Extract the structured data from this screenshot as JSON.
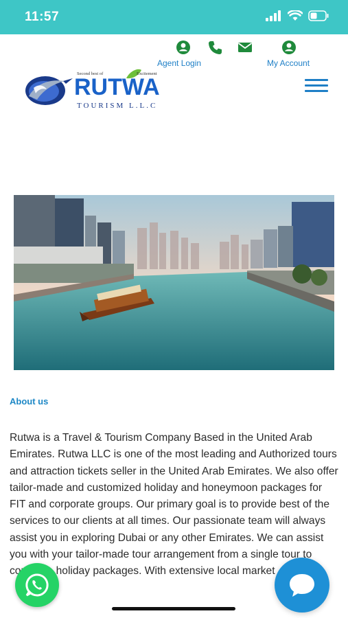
{
  "status_bar": {
    "time": "11:57",
    "icons": [
      "signal-icon",
      "wifi-icon",
      "battery-icon"
    ]
  },
  "topbar": {
    "agent_login": "Agent Login",
    "my_account": "My Account",
    "icons": [
      "user-circle-icon",
      "phone-icon",
      "mail-icon",
      "user-circle-icon"
    ],
    "accent": "#1f8a3b"
  },
  "logo": {
    "name": "RUTWA",
    "tagline": "TOURISM L.L.C",
    "slogan_left": "Second best of",
    "slogan_right": "Excitement"
  },
  "about": {
    "title": "About us",
    "body": "Rutwa is a Travel & Tourism Company Based in the United Arab Emirates. Rutwa LLC is one of the most leading and Authorized tours and attraction tickets seller in the United Arab Emirates. We also offer tailor-made and customized holiday and honeymoon packages for FIT and corporate groups. Our primary goal is to provide best of the services to our clients at all times. Our passionate team will always assist you in exploring Dubai or any other Emirates. We can assist you with your tailor-made tour arrangement from a single tour to complete holiday packages. With extensive local market"
  },
  "colors": {
    "status_bar": "#3ec6c6",
    "link": "#1e7fc6",
    "whatsapp": "#25d366",
    "chat": "#1e90d6"
  }
}
